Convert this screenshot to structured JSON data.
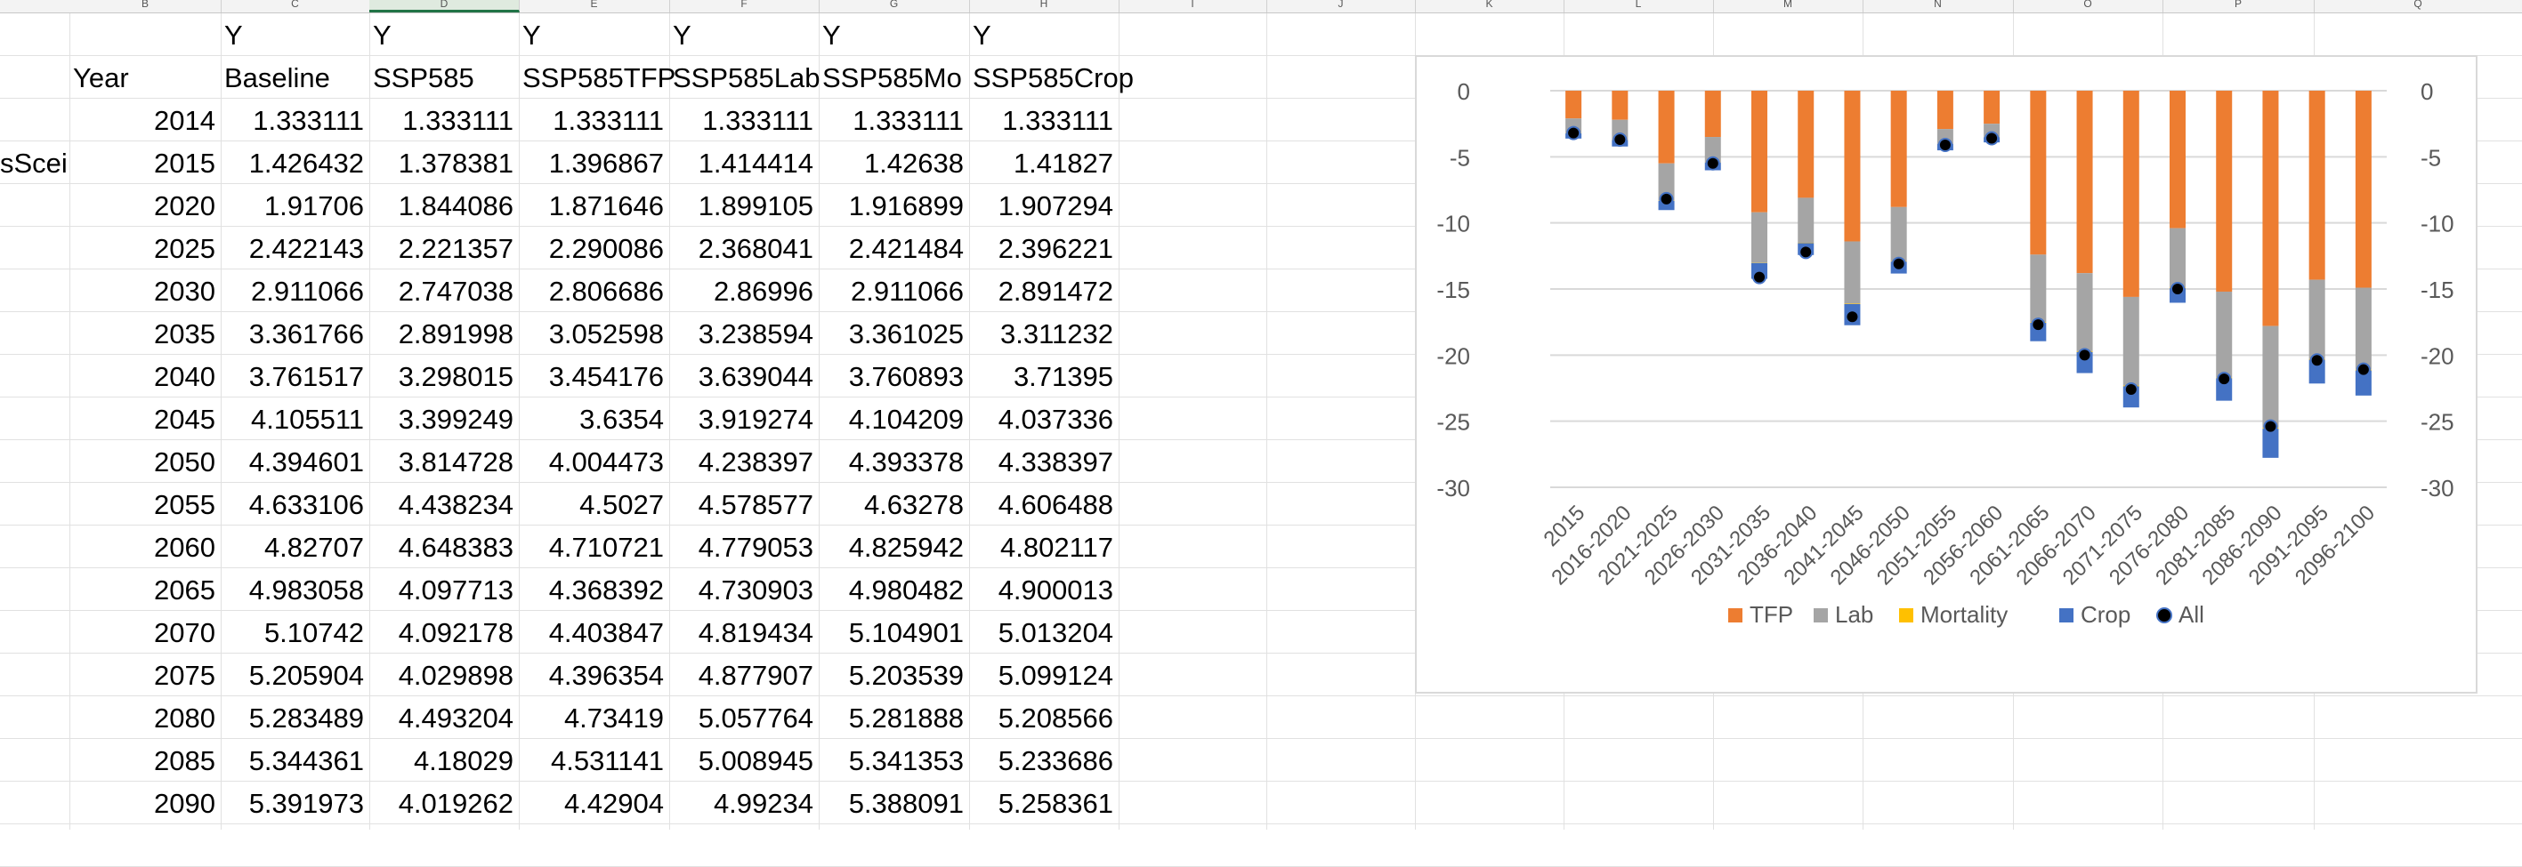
{
  "column_headers": [
    "B",
    "C",
    "D",
    "E",
    "F",
    "G",
    "H",
    "I",
    "J",
    "K",
    "L",
    "M",
    "N",
    "O",
    "P",
    "Q"
  ],
  "partial_left_text": "sScei",
  "table": {
    "row_labels": [
      "Y",
      "Y",
      "Y",
      "Y",
      "Y",
      "Y"
    ],
    "headers": [
      "Year",
      "Baseline",
      "SSP585",
      "SSP585TFP",
      "SSP585Lab",
      "SSP585Mo",
      "SSP585Crop"
    ],
    "rows": [
      [
        "2014",
        "1.333111",
        "1.333111",
        "1.333111",
        "1.333111",
        "1.333111",
        "1.333111"
      ],
      [
        "2015",
        "1.426432",
        "1.378381",
        "1.396867",
        "1.414414",
        "1.42638",
        "1.41827"
      ],
      [
        "2020",
        "1.91706",
        "1.844086",
        "1.871646",
        "1.899105",
        "1.916899",
        "1.907294"
      ],
      [
        "2025",
        "2.422143",
        "2.221357",
        "2.290086",
        "2.368041",
        "2.421484",
        "2.396221"
      ],
      [
        "2030",
        "2.911066",
        "2.747038",
        "2.806686",
        "2.86996",
        "2.911066",
        "2.891472"
      ],
      [
        "2035",
        "3.361766",
        "2.891998",
        "3.052598",
        "3.238594",
        "3.361025",
        "3.311232"
      ],
      [
        "2040",
        "3.761517",
        "3.298015",
        "3.454176",
        "3.639044",
        "3.760893",
        "3.71395"
      ],
      [
        "2045",
        "4.105511",
        "3.399249",
        "3.6354",
        "3.919274",
        "4.104209",
        "4.037336"
      ],
      [
        "2050",
        "4.394601",
        "3.814728",
        "4.004473",
        "4.238397",
        "4.393378",
        "4.338397"
      ],
      [
        "2055",
        "4.633106",
        "4.438234",
        "4.5027",
        "4.578577",
        "4.63278",
        "4.606488"
      ],
      [
        "2060",
        "4.82707",
        "4.648383",
        "4.710721",
        "4.779053",
        "4.825942",
        "4.802117"
      ],
      [
        "2065",
        "4.983058",
        "4.097713",
        "4.368392",
        "4.730903",
        "4.980482",
        "4.900013"
      ],
      [
        "2070",
        "5.10742",
        "4.092178",
        "4.403847",
        "4.819434",
        "5.104901",
        "5.013204"
      ],
      [
        "2075",
        "5.205904",
        "4.029898",
        "4.396354",
        "4.877907",
        "5.203539",
        "5.099124"
      ],
      [
        "2080",
        "5.283489",
        "4.493204",
        "4.73419",
        "5.057764",
        "5.281888",
        "5.208566"
      ],
      [
        "2085",
        "5.344361",
        "4.18029",
        "4.531141",
        "5.008945",
        "5.341353",
        "5.233686"
      ],
      [
        "2090",
        "5.391973",
        "4.019262",
        "4.42904",
        "4.99234",
        "5.388091",
        "5.258361"
      ]
    ]
  },
  "colors": {
    "TFP": "#ed7d31",
    "Lab": "#a5a5a5",
    "Mortality": "#ffc000",
    "Crop": "#4472c4",
    "All": "#000000",
    "selected_header": "#217346"
  },
  "chart_data": {
    "type": "bar",
    "stacked": true,
    "categories": [
      "2015",
      "2016-2020",
      "2021-2025",
      "2026-2030",
      "2031-2035",
      "2036-2040",
      "2041-2045",
      "2046-2050",
      "2051-2055",
      "2056-2060",
      "2061-2065",
      "2066-2070",
      "2071-2075",
      "2076-2080",
      "2081-2085",
      "2086-2090",
      "2091-2095",
      "2096-2100"
    ],
    "series": [
      {
        "name": "TFP",
        "values": [
          -2.1,
          -2.2,
          -5.5,
          -3.5,
          -9.2,
          -8.1,
          -11.4,
          -8.8,
          -2.9,
          -2.5,
          -12.4,
          -13.8,
          -15.6,
          -10.4,
          -15.2,
          -17.8,
          -14.3,
          -14.9
        ]
      },
      {
        "name": "Lab",
        "values": [
          -1.1,
          -1.5,
          -2.8,
          -1.9,
          -3.8,
          -3.4,
          -4.7,
          -4.1,
          -1.1,
          -1.0,
          -5.1,
          -5.9,
          -6.7,
          -4.5,
          -6.5,
          -7.7,
          -6.0,
          -6.2
        ]
      },
      {
        "name": "Mortality",
        "values": [
          -0.02,
          -0.02,
          -0.03,
          -0.02,
          -0.03,
          -0.03,
          -0.04,
          -0.03,
          -0.01,
          -0.01,
          -0.05,
          -0.06,
          -0.06,
          -0.04,
          -0.05,
          -0.07,
          -0.05,
          -0.06
        ]
      },
      {
        "name": "Crop",
        "values": [
          -0.4,
          -0.5,
          -0.7,
          -0.6,
          -1.2,
          -0.9,
          -1.6,
          -0.9,
          -0.5,
          -0.4,
          -1.4,
          -1.6,
          -1.6,
          -1.1,
          -1.7,
          -2.2,
          -1.8,
          -1.9
        ]
      },
      {
        "name": "All",
        "values": [
          -3.2,
          -3.7,
          -8.2,
          -5.5,
          -14.1,
          -12.2,
          -17.1,
          -13.1,
          -4.1,
          -3.6,
          -17.7,
          -20.0,
          -22.6,
          -15.0,
          -21.8,
          -25.4,
          -20.4,
          -21.1
        ]
      }
    ],
    "ylim": [
      -30,
      0
    ],
    "yticks": [
      "0",
      "-5",
      "-10",
      "-15",
      "-20",
      "-25",
      "-30"
    ],
    "ytick_values": [
      0,
      -5,
      -10,
      -15,
      -20,
      -25,
      -30
    ],
    "grid": true,
    "legend": "bottom",
    "xlabel": "",
    "ylabel": ""
  }
}
